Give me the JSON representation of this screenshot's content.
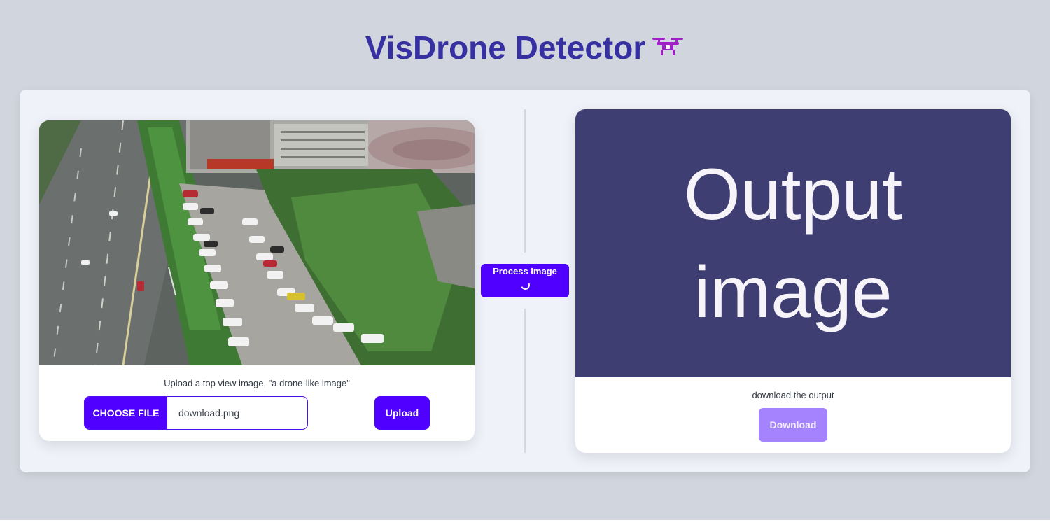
{
  "header": {
    "title": "VisDrone Detector",
    "icon": "drone-icon",
    "title_color": "#3730a3",
    "icon_color": "#a020c8"
  },
  "upload_card": {
    "caption": "Upload a top view image, \"a drone-like image\"",
    "choose_file_label": "CHOOSE FILE",
    "file_name": "download.png",
    "upload_label": "Upload"
  },
  "process": {
    "label": "Process Image",
    "loading_icon": "spinner-icon"
  },
  "output_card": {
    "placeholder_line1": "Output",
    "placeholder_line2": "image",
    "caption": "download the output",
    "download_label": "Download"
  },
  "colors": {
    "accent": "#4f00ff",
    "accent_disabled": "#a583ff",
    "output_bg": "#3f3e72",
    "page_bg": "#d1d5de",
    "panel_bg": "#eff2f8"
  }
}
